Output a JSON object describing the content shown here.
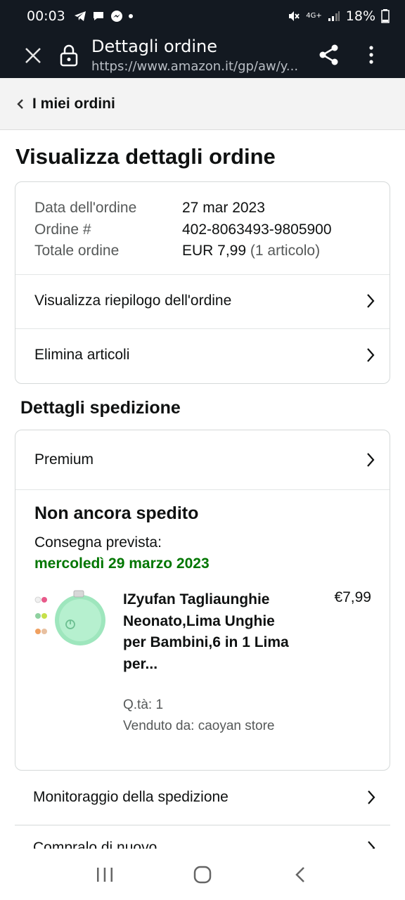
{
  "status_bar": {
    "time": "00:03",
    "network": "4G+",
    "battery": "18%"
  },
  "browser": {
    "title": "Dettagli ordine",
    "url": "https://www.amazon.it/gp/aw/y..."
  },
  "nav": {
    "back_label": "I miei ordini"
  },
  "page": {
    "title": "Visualizza dettagli ordine"
  },
  "order_summary": {
    "rows": [
      {
        "label": "Data dell'ordine",
        "value": "27 mar 2023"
      },
      {
        "label": "Ordine #",
        "value": "402-8063493-9805900"
      },
      {
        "label": "Totale ordine",
        "value": "EUR 7,99",
        "extra": "(1 articolo)"
      }
    ],
    "links": [
      {
        "label": "Visualizza riepilogo dell'ordine"
      },
      {
        "label": "Elimina articoli"
      }
    ]
  },
  "shipment": {
    "section_title": "Dettagli spedizione",
    "shipping_type": "Premium",
    "status": "Non ancora spedito",
    "delivery_label": "Consegna prevista:",
    "delivery_date": "mercoledì 29 marzo 2023",
    "product": {
      "title": "IZyufan Tagliaunghie Neonato,Lima Unghie per Bambini,6 in 1 Lima per...",
      "price": "€7,99",
      "qty": "Q.tà: 1",
      "seller": "Venduto da: caoyan store",
      "image_icon": "nail-trimmer-product-image"
    }
  },
  "actions": [
    {
      "label": "Monitoraggio della spedizione"
    },
    {
      "label": "Compralo di nuovo"
    }
  ],
  "colors": {
    "header_bg": "#131921",
    "delivery_green": "#007600",
    "nav_bg": "#f3f3f3"
  }
}
